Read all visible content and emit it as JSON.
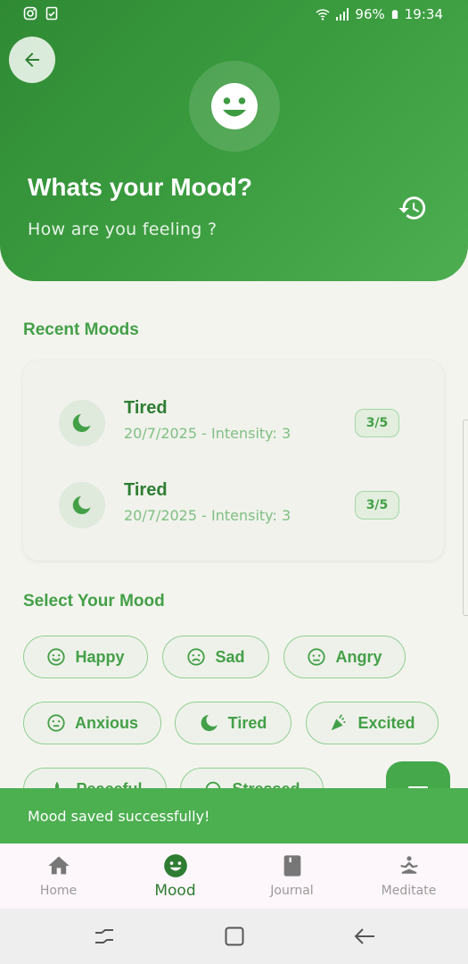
{
  "status_bar": {
    "battery": "96%",
    "time": "19:34",
    "left_icons": [
      "instagram-icon",
      "clipboard-check-icon"
    ],
    "right_icons": [
      "wifi-icon",
      "signal-icon",
      "battery-icon"
    ]
  },
  "header": {
    "title": "Whats your Mood?",
    "subtitle": "How are you feeling ?",
    "center_icon": "smiley-face-icon",
    "back_icon": "back-arrow-icon",
    "history_icon": "history-icon"
  },
  "recent": {
    "title": "Recent Moods",
    "items": [
      {
        "name": "Tired",
        "meta": "20/7/2025 - Intensity: 3",
        "badge": "3/5",
        "icon": "moon-icon"
      },
      {
        "name": "Tired",
        "meta": "20/7/2025 - Intensity: 3",
        "badge": "3/5",
        "icon": "moon-icon"
      }
    ]
  },
  "select": {
    "title": "Select Your Mood",
    "chips": [
      {
        "label": "Happy",
        "icon": "happy-face-icon"
      },
      {
        "label": "Sad",
        "icon": "sad-face-icon"
      },
      {
        "label": "Angry",
        "icon": "angry-face-icon"
      },
      {
        "label": "Anxious",
        "icon": "anxious-face-icon"
      },
      {
        "label": "Tired",
        "icon": "moon-icon"
      },
      {
        "label": "Excited",
        "icon": "party-popper-icon"
      },
      {
        "label": "Peaceful",
        "icon": "spa-icon"
      },
      {
        "label": "Stressed",
        "icon": "stressed-icon"
      }
    ]
  },
  "snackbar": {
    "message": "Mood saved successfully!"
  },
  "bottom_nav": {
    "items": [
      {
        "label": "Home",
        "icon": "home-icon",
        "active": false
      },
      {
        "label": "Mood",
        "icon": "mood-icon",
        "active": true
      },
      {
        "label": "Journal",
        "icon": "journal-icon",
        "active": false
      },
      {
        "label": "Meditate",
        "icon": "meditate-icon",
        "active": false
      }
    ]
  },
  "colors": {
    "primary": "#43a047",
    "primary_dark": "#2e7d32",
    "header_start": "#2f8a34",
    "header_end": "#4cae50",
    "snackbar": "#4caf50",
    "background": "#f4f4ef"
  }
}
